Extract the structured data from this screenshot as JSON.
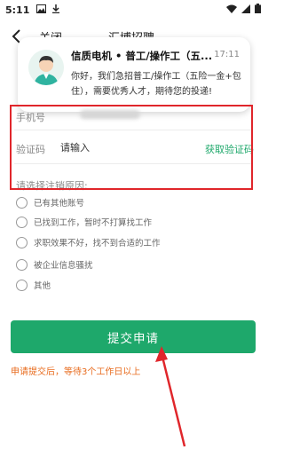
{
  "status_bar": {
    "time": "5:11",
    "icons": [
      "image-icon",
      "download-icon",
      "wifi-icon",
      "signal-icon",
      "battery-icon"
    ]
  },
  "header": {
    "back_icon": "chevron-left-icon",
    "close_label": "关闭",
    "title": "汇博招聘"
  },
  "notification": {
    "title": "信质电机 • 普工/操作工（五...",
    "time": "17:11",
    "body": "你好，我们急招普工/操作工（五险一金+包住），需要优秀人才，期待您的投递!"
  },
  "form": {
    "phone_label": "手机号",
    "code_label": "验证码",
    "code_placeholder": "请输入",
    "get_code_label": "获取验证码",
    "reason_label": "请选择注销原因:"
  },
  "options": [
    {
      "label": "已有其他账号"
    },
    {
      "label": "已找到工作，暂时不打算找工作"
    },
    {
      "label": "求职效果不好，找不到合适的工作"
    },
    {
      "label": "被企业信息骚扰"
    },
    {
      "label": "其他"
    }
  ],
  "submit_label": "提交申请",
  "hint": "申请提交后，等待3个工作日以上",
  "colors": {
    "accent": "#1ea86b",
    "hint": "#e86c1f",
    "annotation": "#e0262b"
  }
}
